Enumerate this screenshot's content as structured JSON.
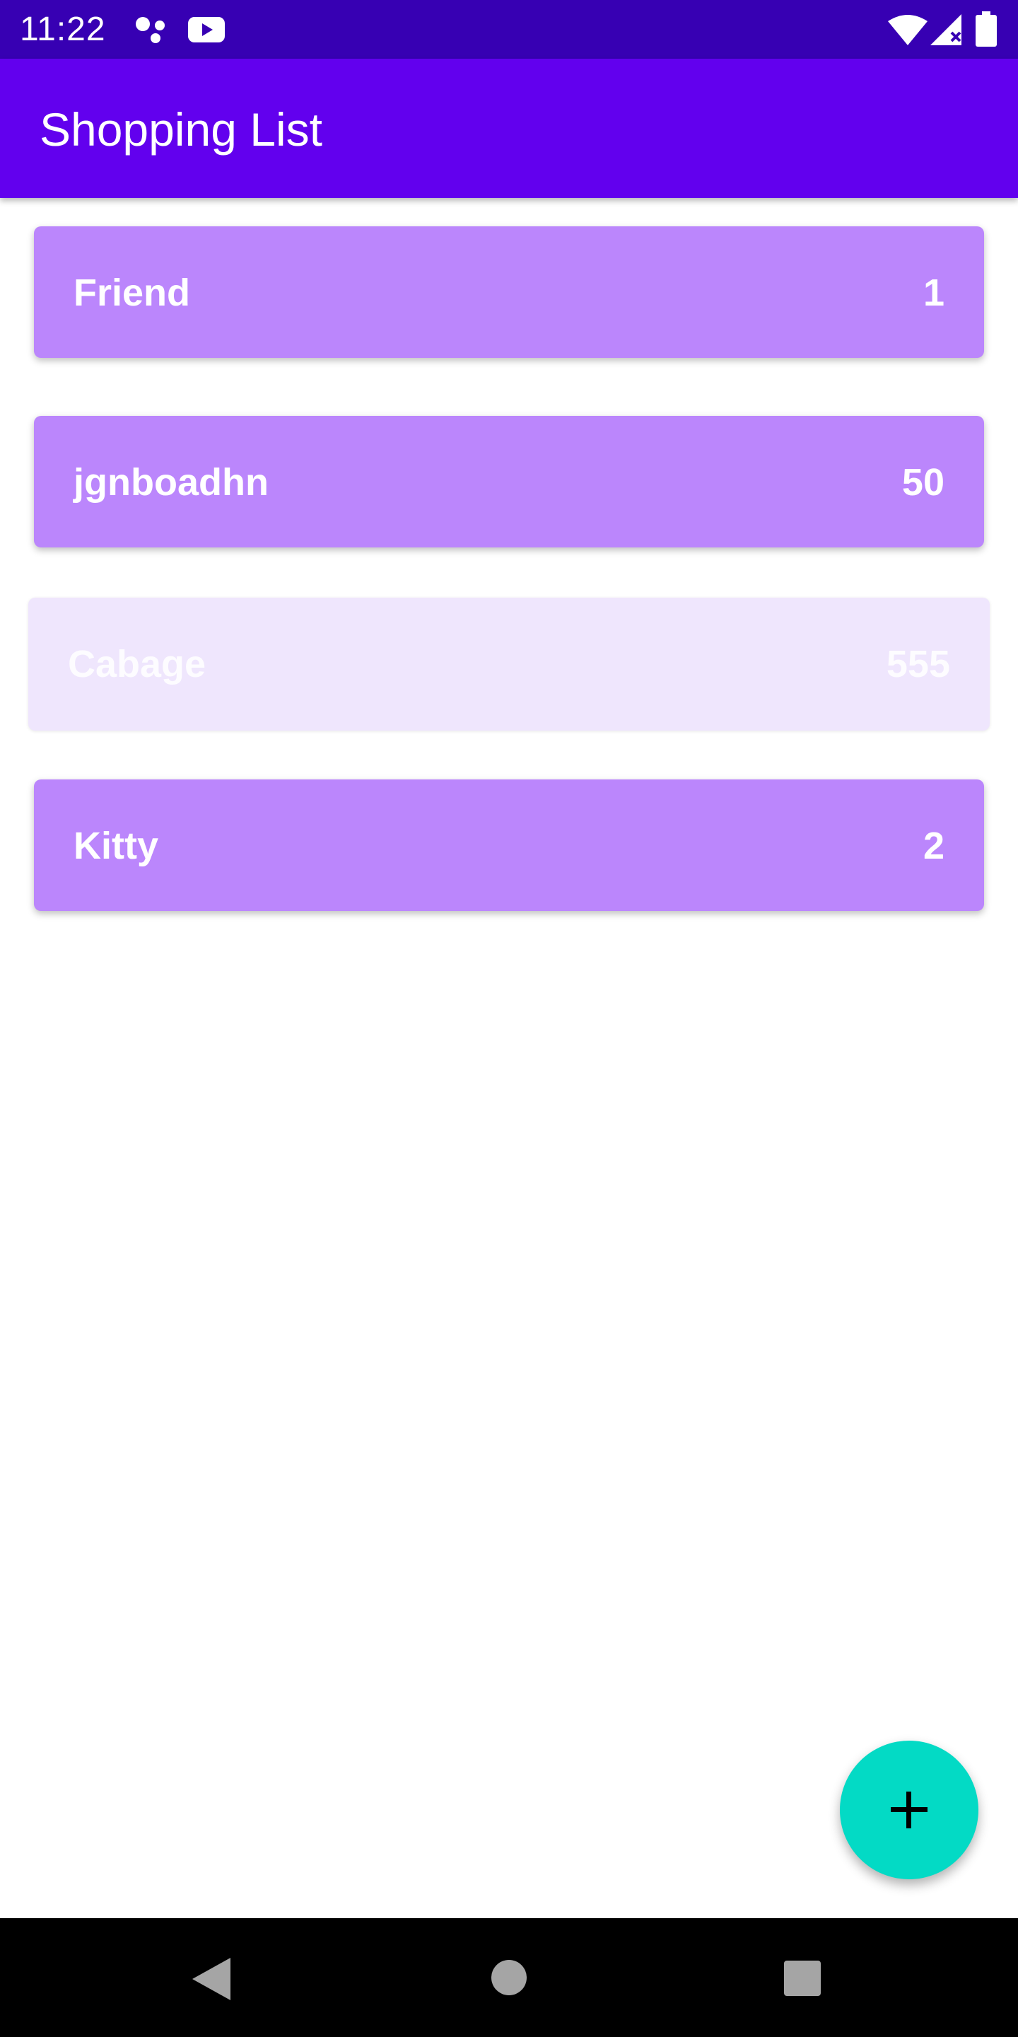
{
  "status_bar": {
    "time": "11:22",
    "icons": [
      "assistant-dots-icon",
      "youtube-icon",
      "wifi-icon",
      "signal-icon",
      "battery-icon"
    ]
  },
  "app_bar": {
    "title": "Shopping List"
  },
  "items": [
    {
      "name": "Friend",
      "quantity": "1"
    },
    {
      "name": "jgnboadhn",
      "quantity": "50"
    },
    {
      "name": "Cabage",
      "quantity": "555"
    },
    {
      "name": "Kitty",
      "quantity": "2"
    }
  ],
  "fab": {
    "icon": "plus-icon"
  },
  "nav_bar": {
    "buttons": [
      "back-icon",
      "home-icon",
      "recents-icon"
    ]
  },
  "colors": {
    "status_bar": "#3700b3",
    "app_bar": "#6200ee",
    "item": "#bb86fc",
    "item_dragging": "#efe6fd",
    "fab": "#03dac5"
  }
}
